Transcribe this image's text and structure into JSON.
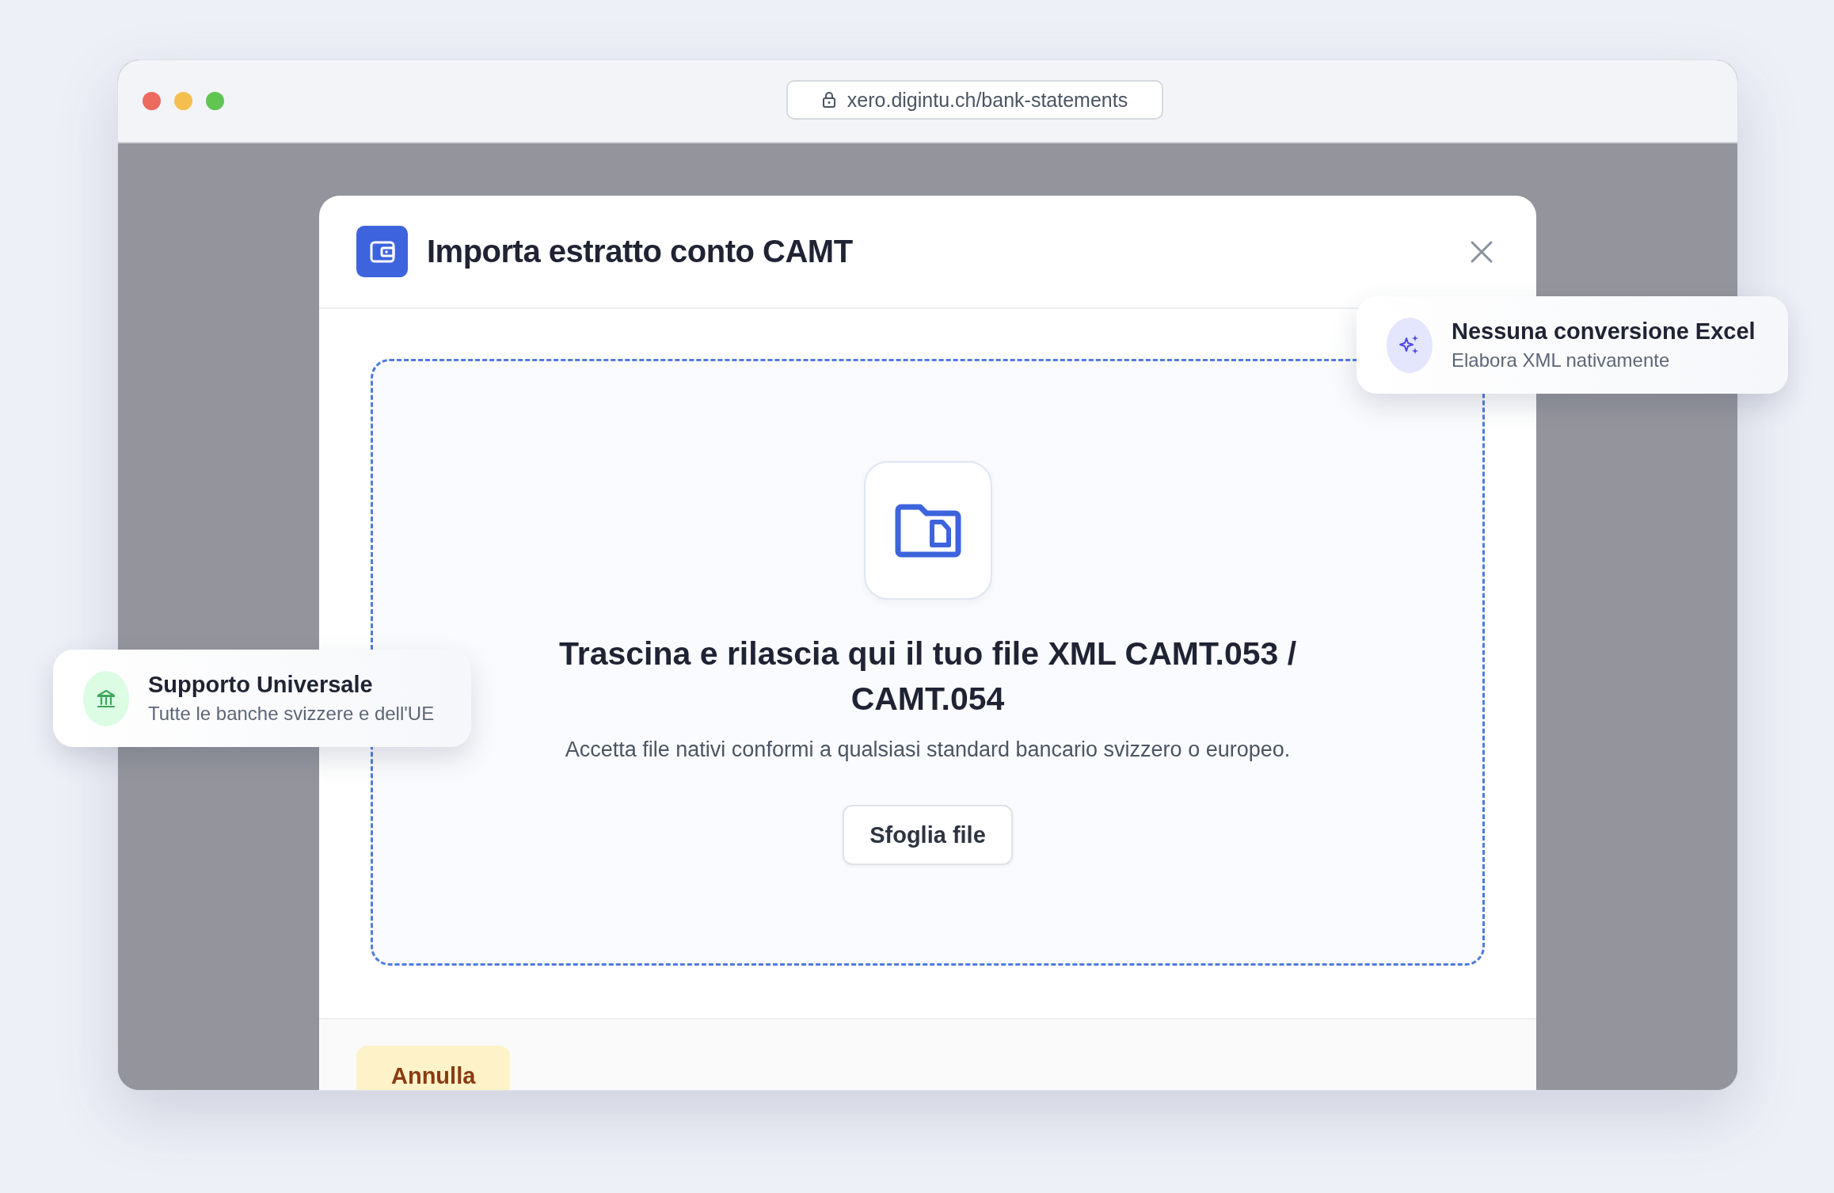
{
  "browser": {
    "url": "xero.digintu.ch/bank-statements"
  },
  "dialog": {
    "title": "Importa estratto conto CAMT",
    "dropzone": {
      "heading": "Trascina e rilascia qui il tuo file XML CAMT.053 / CAMT.054",
      "description": "Accetta file nativi conformi a qualsiasi standard bancario svizzero o europeo.",
      "browse_button": "Sfoglia file"
    },
    "footer": {
      "cancel_button": "Annulla"
    }
  },
  "callouts": [
    {
      "kind": "sparkle",
      "title": "Nessuna conversione Excel",
      "subtitle": "Elabora XML nativamente"
    },
    {
      "kind": "bank",
      "title": "Supporto Universale",
      "subtitle": "Tutte le banche svizzere e dell'UE"
    }
  ]
}
